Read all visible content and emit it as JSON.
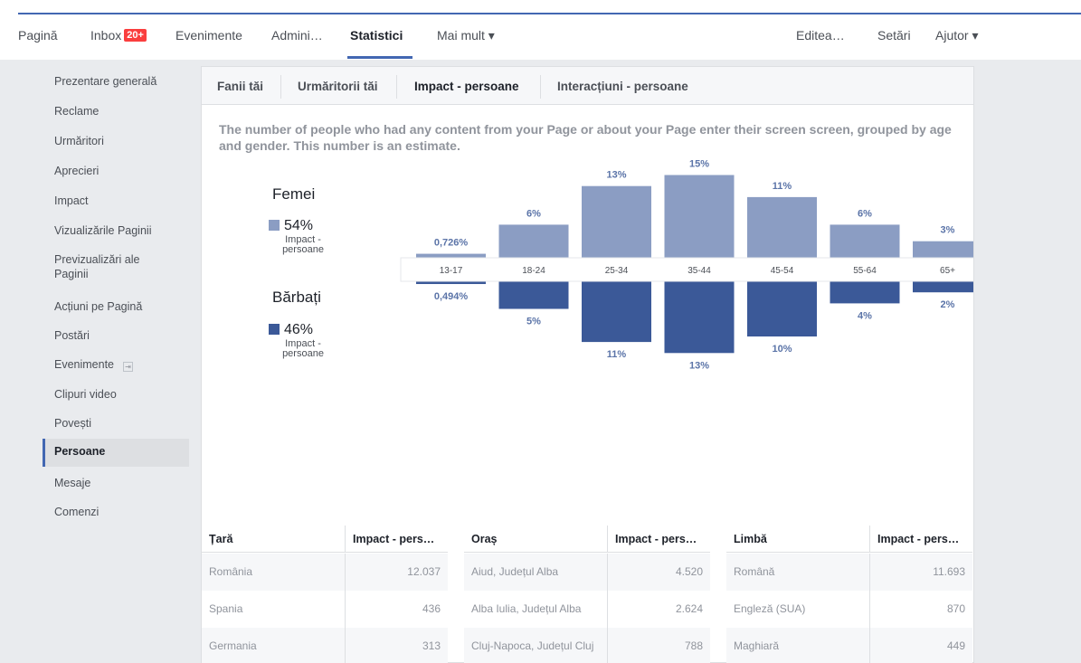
{
  "topnav": {
    "items_left": [
      "Pagină",
      "Inbox",
      "Evenimente",
      "Admini…",
      "Statistici",
      "Mai mult ▾"
    ],
    "inbox_badge": "20+",
    "items_right": [
      "Editea…",
      "Setări",
      "Ajutor ▾"
    ],
    "active": "Statistici"
  },
  "sidebar": {
    "items": [
      "Prezentare generală",
      "Reclame",
      "Urmăritori",
      "Aprecieri",
      "Impact",
      "Vizualizările Paginii",
      "Previzualizări ale Paginii",
      "Acțiuni pe Pagină",
      "Postări",
      "Evenimente",
      "Clipuri video",
      "Povești",
      "Persoane",
      "Mesaje",
      "Comenzi"
    ],
    "active": "Persoane"
  },
  "tabs": [
    "Fanii tăi",
    "Urmăritorii tăi",
    "Impact - persoane",
    "Interacțiuni - persoane"
  ],
  "active_tab": "Impact - persoane",
  "description": "The number of people who had any content from your Page or about your Page enter their screen screen, grouped by age and gender. This number is an estimate.",
  "legend": {
    "women": {
      "title": "Femei",
      "pct": "54%",
      "sub": "Impact - persoane"
    },
    "men": {
      "title": "Bărbați",
      "pct": "46%",
      "sub": "Impact - persoane"
    }
  },
  "colors": {
    "women": "#8b9dc3",
    "men": "#3b5998",
    "accent": "#4267b2"
  },
  "chart_data": {
    "type": "bar",
    "categories": [
      "13-17",
      "18-24",
      "25-34",
      "35-44",
      "45-54",
      "55-64",
      "65+"
    ],
    "series": [
      {
        "name": "Femei",
        "values": [
          0.726,
          6,
          13,
          15,
          11,
          6,
          3
        ],
        "labels": [
          "0,726%",
          "6%",
          "13%",
          "15%",
          "11%",
          "6%",
          "3%"
        ]
      },
      {
        "name": "Bărbați",
        "values": [
          0.494,
          5,
          11,
          13,
          10,
          4,
          2
        ],
        "labels": [
          "0,494%",
          "5%",
          "11%",
          "13%",
          "10%",
          "4%",
          "2%"
        ]
      }
    ]
  },
  "tables": [
    {
      "headers": [
        "Țară",
        "Impact - pers…"
      ],
      "rows": [
        [
          "România",
          "12.037"
        ],
        [
          "Spania",
          "436"
        ],
        [
          "Germania",
          "313"
        ]
      ]
    },
    {
      "headers": [
        "Oraș",
        "Impact - pers…"
      ],
      "rows": [
        [
          "Aiud, Județul Alba",
          "4.520"
        ],
        [
          "Alba Iulia, Județul Alba",
          "2.624"
        ],
        [
          "Cluj-Napoca, Județul Cluj",
          "788"
        ]
      ]
    },
    {
      "headers": [
        "Limbă",
        "Impact - pers…"
      ],
      "rows": [
        [
          "Română",
          "11.693"
        ],
        [
          "Engleză (SUA)",
          "870"
        ],
        [
          "Maghiară",
          "449"
        ]
      ]
    }
  ]
}
